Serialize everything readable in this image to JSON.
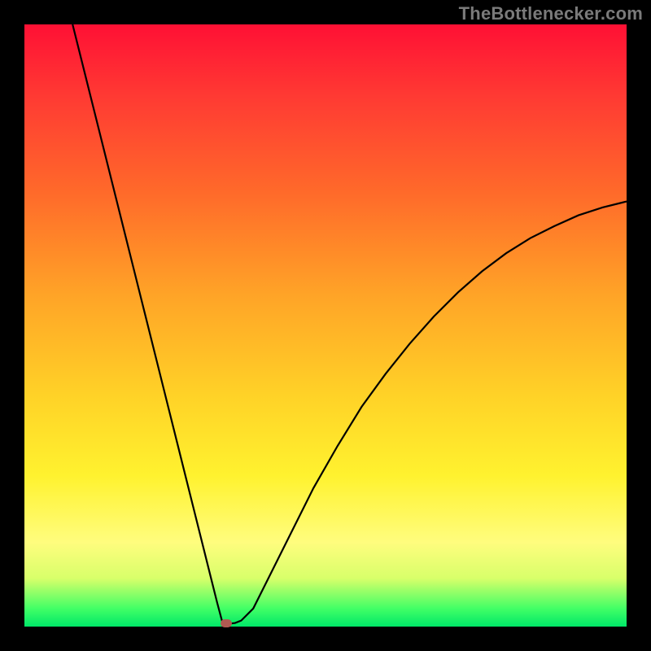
{
  "watermark": "TheBottlenecker.com",
  "colors": {
    "curve": "#000000",
    "marker": "#b05a52",
    "frame_bg": "#000000"
  },
  "chart_data": {
    "type": "line",
    "title": "",
    "xlabel": "",
    "ylabel": "",
    "xlim": [
      0,
      100
    ],
    "ylim": [
      0,
      100
    ],
    "curve": {
      "x": [
        8,
        10,
        12,
        14,
        16,
        18,
        20,
        22,
        24,
        26,
        28,
        30,
        31,
        32,
        32.8,
        33.5,
        34.2,
        35,
        36,
        38,
        40,
        44,
        48,
        52,
        56,
        60,
        64,
        68,
        72,
        76,
        80,
        84,
        88,
        92,
        96,
        100
      ],
      "y": [
        100,
        92,
        84,
        76,
        68,
        60,
        52,
        44,
        36,
        28,
        20,
        12,
        8,
        4,
        1,
        0.5,
        0.5,
        0.6,
        1.0,
        3,
        7,
        15,
        23,
        30,
        36.5,
        42,
        47,
        51.5,
        55.5,
        59,
        62,
        64.5,
        66.5,
        68.3,
        69.6,
        70.6
      ]
    },
    "min_marker": {
      "x": 33.5,
      "y": 0.5
    }
  }
}
